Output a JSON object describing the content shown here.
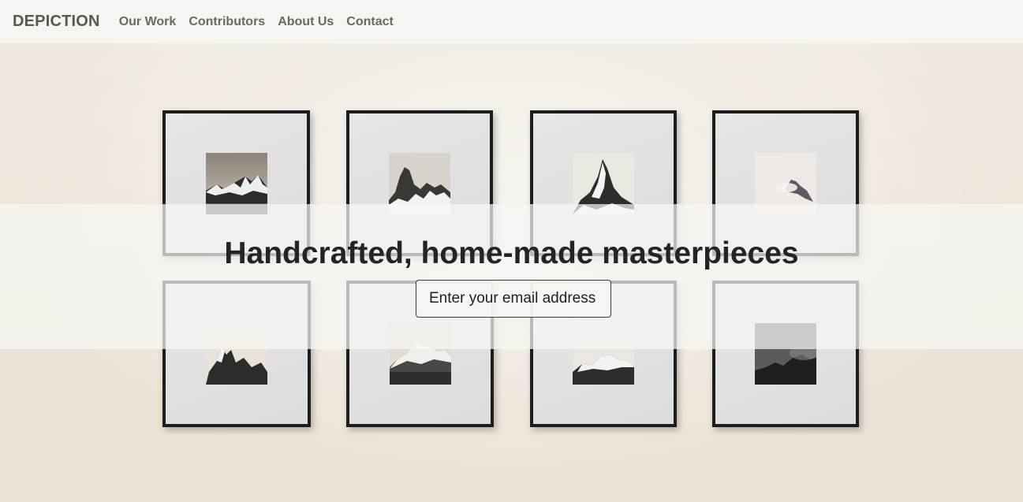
{
  "nav": {
    "brand": "DEPICTION",
    "links": [
      "Our Work",
      "Contributors",
      "About Us",
      "Contact"
    ]
  },
  "hero": {
    "title": "Handcrafted, home-made masterpieces",
    "email_placeholder": "Enter your email address"
  },
  "gallery": {
    "frame_count": 8,
    "rows": 2,
    "columns": 4,
    "photo_subject": "black-and-white mountain peaks"
  },
  "colors": {
    "wall": "#ece4d9",
    "frame": "#1d1d1d",
    "mat": "#e2e2e2",
    "title_text": "#212529",
    "nav_text": "#6b6862"
  }
}
